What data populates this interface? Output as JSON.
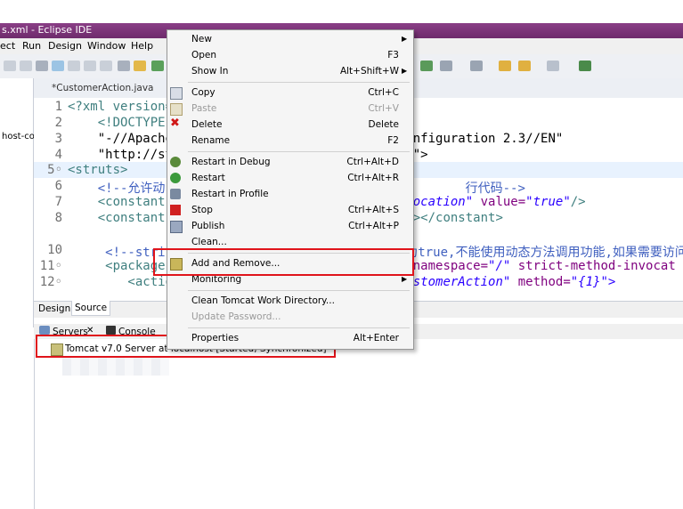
{
  "window": {
    "title": "s.xml - Eclipse IDE"
  },
  "menubar": [
    "ect",
    "Run",
    "Design",
    "Window",
    "Help"
  ],
  "editor": {
    "tabs": [
      "*CustomerAction.java"
    ],
    "left_pane_label": "host-co",
    "bottom_tabs": {
      "design": "Design",
      "source": "Source"
    },
    "lines": [
      {
        "n": "1",
        "segments": [
          {
            "t": "<?xml version=",
            "c": "tag"
          }
        ]
      },
      {
        "n": "2",
        "segments": [
          {
            "t": "    <!DOCTYPE ",
            "c": "tag"
          }
        ]
      },
      {
        "n": "3",
        "segments": [
          {
            "t": "    \"-//Apache",
            "c": "plain"
          },
          {
            "t": "                               onfiguration 2.3//EN\"",
            "c": "plain"
          }
        ]
      },
      {
        "n": "4",
        "segments": [
          {
            "t": "    \"http://st",
            "c": "plain"
          },
          {
            "t": "                               d\">",
            "c": "plain"
          }
        ]
      },
      {
        "n": "5◦",
        "segments": [
          {
            "t": "<struts>",
            "c": "tag"
          }
        ]
      },
      {
        "n": "6",
        "segments": [
          {
            "t": "    <!--允许动",
            "c": "cmt"
          },
          {
            "t": "                                        行代码-->",
            "c": "cmt"
          }
        ]
      },
      {
        "n": "7",
        "segments": [
          {
            "t": "    <constant",
            "c": "tag"
          },
          {
            "t": "                               nvocation\"",
            "c": "str"
          },
          {
            "t": " value=",
            "c": "attr"
          },
          {
            "t": "\"true\"",
            "c": "str"
          },
          {
            "t": "/>",
            "c": "tag"
          }
        ]
      },
      {
        "n": "8",
        "segments": [
          {
            "t": "    <constant",
            "c": "tag"
          },
          {
            "t": "                                \"></constant>",
            "c": "tag"
          }
        ]
      },
      {
        "n": "10",
        "segments": [
          {
            "t": "     <!--stri",
            "c": "cmt"
          },
          {
            "t": "                                为true,不能使用动态方法调用功能,如果需要访问多个",
            "c": "cmt"
          }
        ]
      },
      {
        "n": "11◦",
        "segments": [
          {
            "t": "     <package",
            "c": "tag"
          },
          {
            "t": "                               \"",
            "c": "str"
          },
          {
            "t": " namespace=",
            "c": "attr"
          },
          {
            "t": "\"/\"",
            "c": "str"
          },
          {
            "t": " strict-method-invocat",
            "c": "attr"
          }
        ]
      },
      {
        "n": "12◦",
        "segments": [
          {
            "t": "        <actio",
            "c": "tag"
          },
          {
            "t": "                             .CustomerAction\"",
            "c": "str"
          },
          {
            "t": " method=",
            "c": "attr"
          },
          {
            "t": "\"{1}\">",
            "c": "str"
          }
        ]
      }
    ]
  },
  "views": {
    "servers_tab": "Servers",
    "console_tab": "Console",
    "server_entry": "Tomcat v7.0 Server at localhost  [Started, Synchronized]"
  },
  "context_menu": {
    "items": [
      {
        "label": "New",
        "shortcut": "",
        "submenu": true,
        "disabled": false,
        "icon": "none"
      },
      {
        "label": "Open",
        "shortcut": "F3",
        "submenu": false,
        "disabled": false,
        "icon": "none"
      },
      {
        "label": "Show In",
        "shortcut": "Alt+Shift+W",
        "submenu": true,
        "disabled": false,
        "icon": "none"
      },
      {
        "label": "Copy",
        "shortcut": "Ctrl+C",
        "submenu": false,
        "disabled": false,
        "icon": "copy-icon"
      },
      {
        "label": "Paste",
        "shortcut": "Ctrl+V",
        "submenu": false,
        "disabled": true,
        "icon": "paste-icon"
      },
      {
        "label": "Delete",
        "shortcut": "Delete",
        "submenu": false,
        "disabled": false,
        "icon": "delete-icon"
      },
      {
        "label": "Rename",
        "shortcut": "F2",
        "submenu": false,
        "disabled": false,
        "icon": "none"
      },
      {
        "label": "Restart in Debug",
        "shortcut": "Ctrl+Alt+D",
        "submenu": false,
        "disabled": false,
        "icon": "debug-icon"
      },
      {
        "label": "Restart",
        "shortcut": "Ctrl+Alt+R",
        "submenu": false,
        "disabled": false,
        "icon": "run-icon"
      },
      {
        "label": "Restart in Profile",
        "shortcut": "",
        "submenu": false,
        "disabled": false,
        "icon": "profile-icon"
      },
      {
        "label": "Stop",
        "shortcut": "Ctrl+Alt+S",
        "submenu": false,
        "disabled": false,
        "icon": "stop-icon"
      },
      {
        "label": "Publish",
        "shortcut": "Ctrl+Alt+P",
        "submenu": false,
        "disabled": false,
        "icon": "publish-icon"
      },
      {
        "label": "Clean...",
        "shortcut": "",
        "submenu": false,
        "disabled": false,
        "icon": "none"
      },
      {
        "label": "Add and Remove...",
        "shortcut": "",
        "submenu": false,
        "disabled": false,
        "icon": "add-remove-icon"
      },
      {
        "label": "Monitoring",
        "shortcut": "",
        "submenu": true,
        "disabled": false,
        "icon": "none"
      },
      {
        "label": "Clean Tomcat Work Directory...",
        "shortcut": "",
        "submenu": false,
        "disabled": false,
        "icon": "none"
      },
      {
        "label": "Update Password...",
        "shortcut": "",
        "submenu": false,
        "disabled": true,
        "icon": "none"
      },
      {
        "label": "Properties",
        "shortcut": "Alt+Enter",
        "submenu": false,
        "disabled": false,
        "icon": "none"
      }
    ]
  },
  "colors": {
    "highlight_box": "#e0141b",
    "title_bar": "#7a3477"
  }
}
